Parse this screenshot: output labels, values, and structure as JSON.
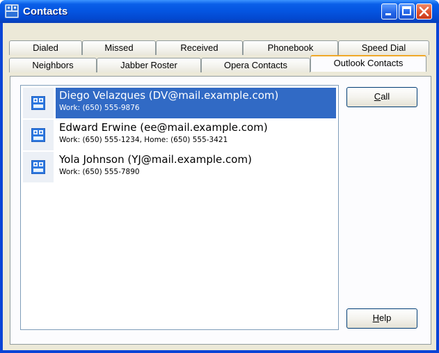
{
  "window": {
    "title": "Contacts",
    "icon": "contacts-app-icon",
    "controls": [
      "minimize-icon",
      "maximize-icon",
      "close-icon"
    ]
  },
  "tabs": {
    "row1": [
      {
        "label": "Dialed"
      },
      {
        "label": "Missed"
      },
      {
        "label": "Received"
      },
      {
        "label": "Phonebook"
      },
      {
        "label": "Speed Dial"
      }
    ],
    "row2": [
      {
        "label": "Neighbors"
      },
      {
        "label": "Jabber Roster"
      },
      {
        "label": "Opera Contacts"
      },
      {
        "label": "Outlook Contacts"
      }
    ],
    "active": "Outlook Contacts"
  },
  "contacts": [
    {
      "name": "Diego Velazques (DV@mail.example.com)",
      "detail": "Work: (650) 555-9876",
      "selected": true,
      "icon": "contact-card-icon"
    },
    {
      "name": "Edward Erwine (ee@mail.example.com)",
      "detail": "Work: (650) 555-1234, Home: (650) 555-3421",
      "selected": false,
      "icon": "contact-card-icon"
    },
    {
      "name": "Yola Johnson (YJ@mail.example.com)",
      "detail": "Work: (650) 555-7890",
      "selected": false,
      "icon": "contact-card-icon"
    }
  ],
  "buttons": {
    "call": {
      "mnemonic": "C",
      "rest": "all"
    },
    "help": {
      "mnemonic": "H",
      "rest": "elp"
    }
  },
  "colors": {
    "titlebar": "#0454e0",
    "selection": "#316ac5",
    "active_tab_accent": "#f0a828",
    "dialog_background": "#ece9d8"
  }
}
